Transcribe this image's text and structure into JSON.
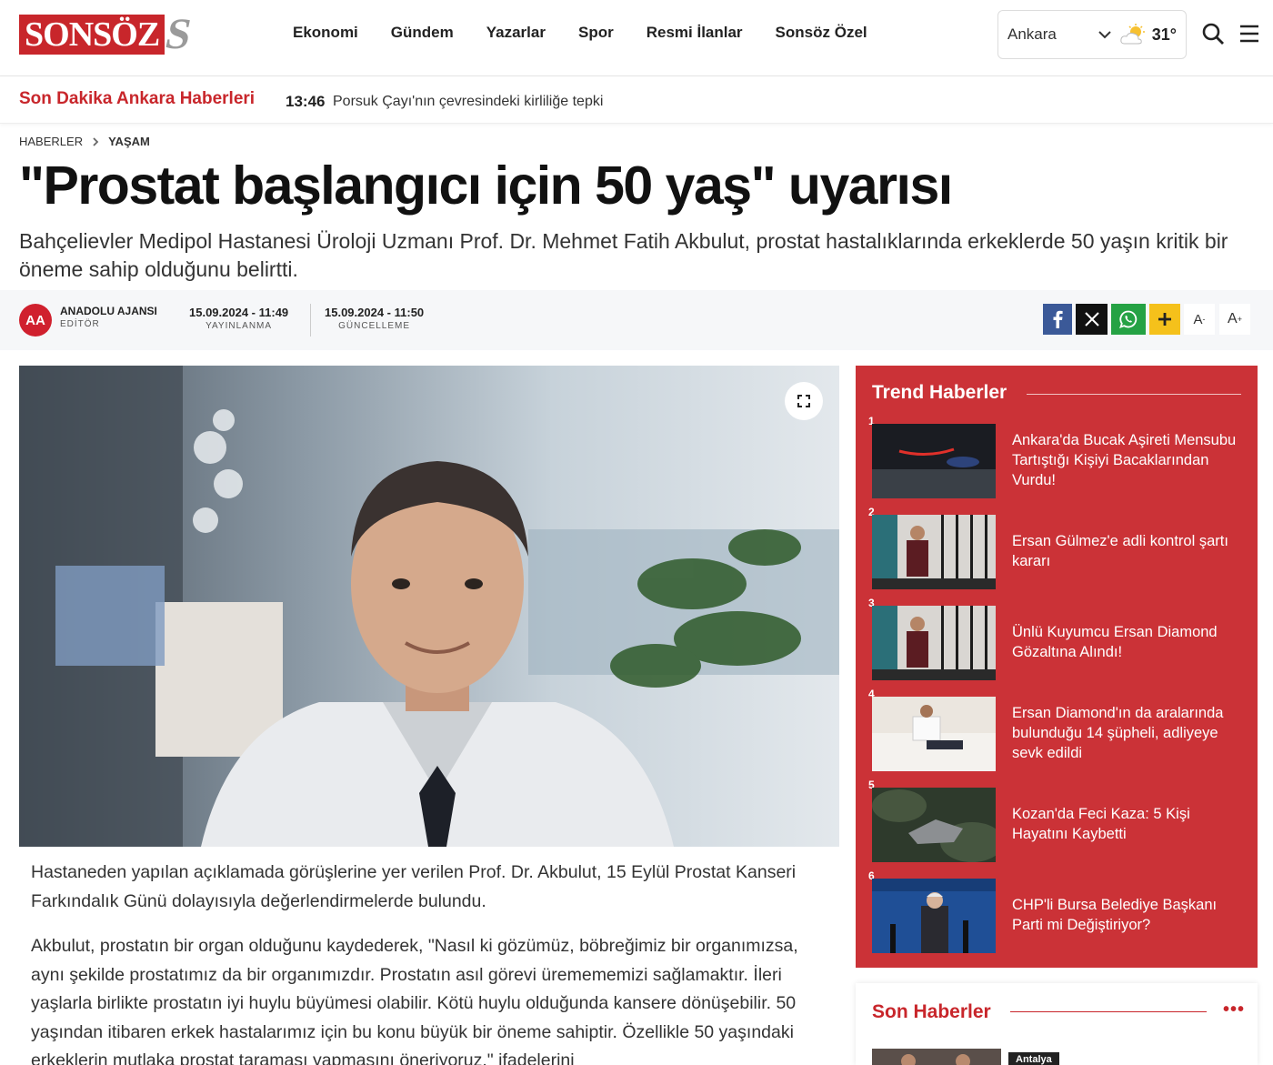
{
  "header": {
    "logo_text": "SONSÖZ",
    "logo_mark": "S",
    "nav": [
      {
        "label": "Ekonomi"
      },
      {
        "label": "Gündem"
      },
      {
        "label": "Yazarlar"
      },
      {
        "label": "Spor"
      },
      {
        "label": "Resmi İlanlar"
      },
      {
        "label": "Sonsöz Özel"
      }
    ],
    "weather": {
      "city": "Ankara",
      "temp": "31°",
      "icon": "partly-cloudy-icon"
    }
  },
  "ticker": {
    "label": "Son Dakika Ankara Haberleri",
    "time": "13:46",
    "text": "Porsuk Çayı'nın çevresindeki kirliliğe tepki"
  },
  "breadcrumb": {
    "root": "HABERLER",
    "current": "YAŞAM"
  },
  "article": {
    "title": "\"Prostat başlangıcı için 50 yaş\" uyarısı",
    "spot": "Bahçelievler Medipol Hastanesi Üroloji Uzmanı Prof. Dr. Mehmet Fatih Akbulut, prostat hastalıklarında erkeklerde 50 yaşın kritik bir öneme sahip olduğunu belirtti.",
    "source": {
      "initials": "AA",
      "name": "ANADOLU AJANSI",
      "role": "EDİTÖR"
    },
    "published": {
      "value": "15.09.2024 - 11:49",
      "label": "YAYINLANMA"
    },
    "updated": {
      "value": "15.09.2024 - 11:50",
      "label": "GÜNCELLEME"
    },
    "font_buttons": {
      "smaller": "A",
      "smaller_sup": "-",
      "larger": "A",
      "larger_sup": "+"
    },
    "paragraphs": [
      "Hastaneden yapılan açıklamada görüşlerine yer verilen Prof. Dr. Akbulut, 15 Eylül Prostat Kanseri Farkındalık Günü dolayısıyla değerlendirmelerde bulundu.",
      "Akbulut, prostatın bir organ olduğunu kaydederek, \"Nasıl ki gözümüz, böbreğimiz bir organımızsa, aynı şekilde prostatımız da bir organımızdır. Prostatın asıl görevi üremememizi sağlamaktır. İleri yaşlarla birlikte prostatın iyi huylu büyümesi olabilir. Kötü huylu olduğunda kansere dönüşebilir. 50 yaşından itibaren erkek hastalarımız için bu konu büyük bir öneme sahiptir. Özellikle 50 yaşındaki erkeklerin mutlaka prostat taraması yapmasını öneriyoruz.\" ifadelerini"
    ]
  },
  "trend": {
    "title": "Trend Haberler",
    "items": [
      {
        "num": "1",
        "title": "Ankara'da Bucak Aşireti Mensubu Tartıştığı Kişiyi Bacaklarından Vurdu!"
      },
      {
        "num": "2",
        "title": "Ersan Gülmez'e adli kontrol şartı kararı"
      },
      {
        "num": "3",
        "title": "Ünlü Kuyumcu Ersan Diamond Gözaltına Alındı!"
      },
      {
        "num": "4",
        "title": "Ersan Diamond'ın da aralarında bulunduğu 14 şüpheli, adliyeye sevk edildi"
      },
      {
        "num": "5",
        "title": "Kozan'da Feci Kaza: 5 Kişi Hayatını Kaybetti"
      },
      {
        "num": "6",
        "title": "CHP'li Bursa Belediye Başkanı Parti mi Değiştiriyor?"
      }
    ]
  },
  "son_haberler": {
    "title": "Son Haberler",
    "dots": "•••",
    "first_category": "Antalya"
  },
  "colors": {
    "brand": "#c8262b",
    "facebook": "#3b5998",
    "x": "#111111",
    "whatsapp": "#25a244",
    "plus": "#f5c11b"
  }
}
